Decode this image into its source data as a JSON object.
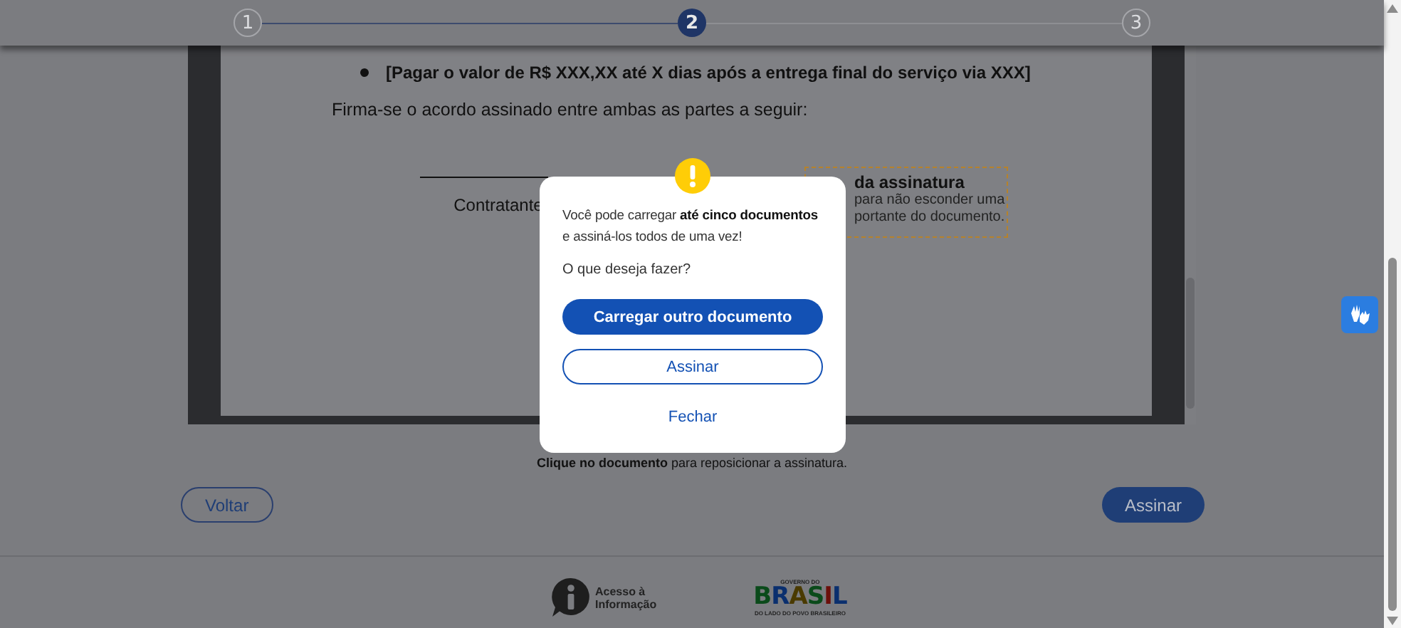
{
  "stepper": {
    "steps": [
      {
        "label": "1",
        "selected": false
      },
      {
        "label": "2",
        "selected": true
      },
      {
        "label": "3",
        "selected": false
      }
    ]
  },
  "document": {
    "bullets": [
      {
        "text": "[Pagar o valor de R$ XXX,XX até X dias após a entrega final do serviço via XXX]"
      }
    ],
    "paragraph": "Firma-se o acordo assinado entre ambas as partes a seguir:",
    "signature_label": "Contratante",
    "signature_box": {
      "title": "da assinatura",
      "lines": [
        "para não esconder uma",
        "portante do documento."
      ]
    }
  },
  "caption": "**Clique no documento** para reposicionar a assinatura.",
  "actions": {
    "back": "Voltar",
    "sign": "Assinar"
  },
  "footer": {
    "access_info": [
      "Acesso à",
      "Informação"
    ],
    "logo": {
      "top": "GOVERNO DO",
      "word": "BRASIL",
      "bottom": "DO LADO DO POVO BRASILEIRO"
    }
  },
  "modal": {
    "message": "Você pode carregar **até cinco documentos** e assiná-los todos de uma vez!",
    "question": "O que deseja fazer?",
    "buttons": [
      {
        "label": "Carregar outro documento",
        "kind": "primary"
      },
      {
        "label": "Assinar",
        "kind": "outline"
      },
      {
        "label": "Fechar",
        "kind": "link"
      }
    ]
  }
}
